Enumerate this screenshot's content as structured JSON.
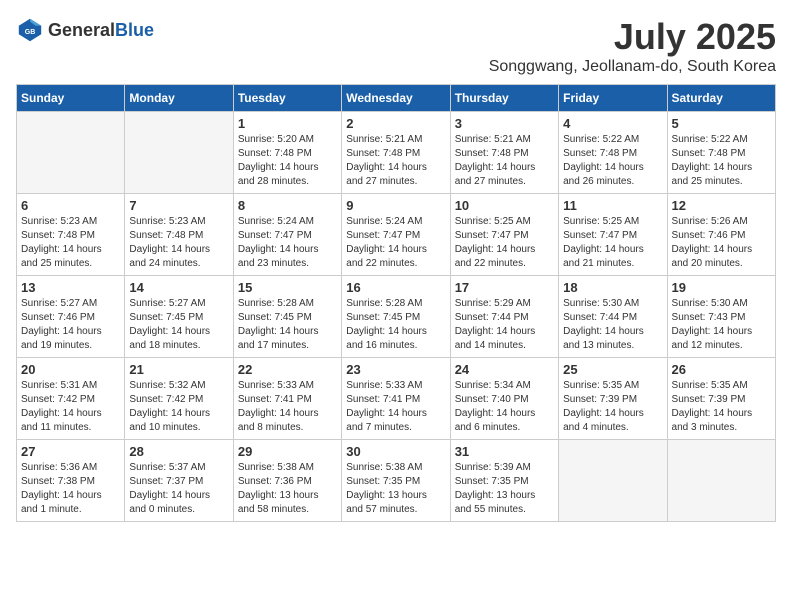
{
  "header": {
    "logo_general": "General",
    "logo_blue": "Blue",
    "month": "July 2025",
    "location": "Songgwang, Jeollanam-do, South Korea"
  },
  "days_of_week": [
    "Sunday",
    "Monday",
    "Tuesday",
    "Wednesday",
    "Thursday",
    "Friday",
    "Saturday"
  ],
  "weeks": [
    [
      {
        "day": "",
        "content": ""
      },
      {
        "day": "",
        "content": ""
      },
      {
        "day": "1",
        "content": "Sunrise: 5:20 AM\nSunset: 7:48 PM\nDaylight: 14 hours\nand 28 minutes."
      },
      {
        "day": "2",
        "content": "Sunrise: 5:21 AM\nSunset: 7:48 PM\nDaylight: 14 hours\nand 27 minutes."
      },
      {
        "day": "3",
        "content": "Sunrise: 5:21 AM\nSunset: 7:48 PM\nDaylight: 14 hours\nand 27 minutes."
      },
      {
        "day": "4",
        "content": "Sunrise: 5:22 AM\nSunset: 7:48 PM\nDaylight: 14 hours\nand 26 minutes."
      },
      {
        "day": "5",
        "content": "Sunrise: 5:22 AM\nSunset: 7:48 PM\nDaylight: 14 hours\nand 25 minutes."
      }
    ],
    [
      {
        "day": "6",
        "content": "Sunrise: 5:23 AM\nSunset: 7:48 PM\nDaylight: 14 hours\nand 25 minutes."
      },
      {
        "day": "7",
        "content": "Sunrise: 5:23 AM\nSunset: 7:48 PM\nDaylight: 14 hours\nand 24 minutes."
      },
      {
        "day": "8",
        "content": "Sunrise: 5:24 AM\nSunset: 7:47 PM\nDaylight: 14 hours\nand 23 minutes."
      },
      {
        "day": "9",
        "content": "Sunrise: 5:24 AM\nSunset: 7:47 PM\nDaylight: 14 hours\nand 22 minutes."
      },
      {
        "day": "10",
        "content": "Sunrise: 5:25 AM\nSunset: 7:47 PM\nDaylight: 14 hours\nand 22 minutes."
      },
      {
        "day": "11",
        "content": "Sunrise: 5:25 AM\nSunset: 7:47 PM\nDaylight: 14 hours\nand 21 minutes."
      },
      {
        "day": "12",
        "content": "Sunrise: 5:26 AM\nSunset: 7:46 PM\nDaylight: 14 hours\nand 20 minutes."
      }
    ],
    [
      {
        "day": "13",
        "content": "Sunrise: 5:27 AM\nSunset: 7:46 PM\nDaylight: 14 hours\nand 19 minutes."
      },
      {
        "day": "14",
        "content": "Sunrise: 5:27 AM\nSunset: 7:45 PM\nDaylight: 14 hours\nand 18 minutes."
      },
      {
        "day": "15",
        "content": "Sunrise: 5:28 AM\nSunset: 7:45 PM\nDaylight: 14 hours\nand 17 minutes."
      },
      {
        "day": "16",
        "content": "Sunrise: 5:28 AM\nSunset: 7:45 PM\nDaylight: 14 hours\nand 16 minutes."
      },
      {
        "day": "17",
        "content": "Sunrise: 5:29 AM\nSunset: 7:44 PM\nDaylight: 14 hours\nand 14 minutes."
      },
      {
        "day": "18",
        "content": "Sunrise: 5:30 AM\nSunset: 7:44 PM\nDaylight: 14 hours\nand 13 minutes."
      },
      {
        "day": "19",
        "content": "Sunrise: 5:30 AM\nSunset: 7:43 PM\nDaylight: 14 hours\nand 12 minutes."
      }
    ],
    [
      {
        "day": "20",
        "content": "Sunrise: 5:31 AM\nSunset: 7:42 PM\nDaylight: 14 hours\nand 11 minutes."
      },
      {
        "day": "21",
        "content": "Sunrise: 5:32 AM\nSunset: 7:42 PM\nDaylight: 14 hours\nand 10 minutes."
      },
      {
        "day": "22",
        "content": "Sunrise: 5:33 AM\nSunset: 7:41 PM\nDaylight: 14 hours\nand 8 minutes."
      },
      {
        "day": "23",
        "content": "Sunrise: 5:33 AM\nSunset: 7:41 PM\nDaylight: 14 hours\nand 7 minutes."
      },
      {
        "day": "24",
        "content": "Sunrise: 5:34 AM\nSunset: 7:40 PM\nDaylight: 14 hours\nand 6 minutes."
      },
      {
        "day": "25",
        "content": "Sunrise: 5:35 AM\nSunset: 7:39 PM\nDaylight: 14 hours\nand 4 minutes."
      },
      {
        "day": "26",
        "content": "Sunrise: 5:35 AM\nSunset: 7:39 PM\nDaylight: 14 hours\nand 3 minutes."
      }
    ],
    [
      {
        "day": "27",
        "content": "Sunrise: 5:36 AM\nSunset: 7:38 PM\nDaylight: 14 hours\nand 1 minute."
      },
      {
        "day": "28",
        "content": "Sunrise: 5:37 AM\nSunset: 7:37 PM\nDaylight: 14 hours\nand 0 minutes."
      },
      {
        "day": "29",
        "content": "Sunrise: 5:38 AM\nSunset: 7:36 PM\nDaylight: 13 hours\nand 58 minutes."
      },
      {
        "day": "30",
        "content": "Sunrise: 5:38 AM\nSunset: 7:35 PM\nDaylight: 13 hours\nand 57 minutes."
      },
      {
        "day": "31",
        "content": "Sunrise: 5:39 AM\nSunset: 7:35 PM\nDaylight: 13 hours\nand 55 minutes."
      },
      {
        "day": "",
        "content": ""
      },
      {
        "day": "",
        "content": ""
      }
    ]
  ]
}
